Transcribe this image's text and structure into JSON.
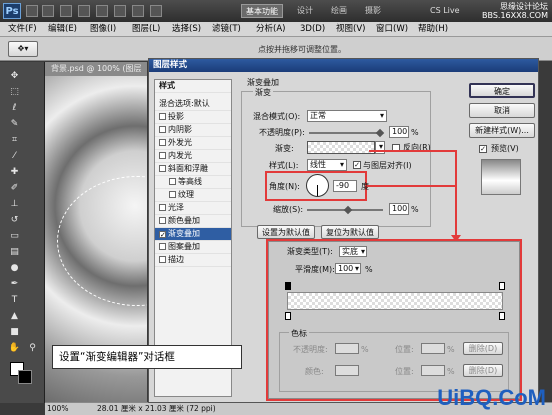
{
  "topbar": {
    "logo": "Ps",
    "workspace": "基本功能",
    "tabs": [
      "设计",
      "绘画",
      "摄影"
    ],
    "cslive": "CS Live",
    "watermark_line1": "思缘设计论坛",
    "watermark_line2": "BBS.16XX8.COM"
  },
  "menu": [
    "文件(F)",
    "编辑(E)",
    "图像(I)",
    "图层(L)",
    "选择(S)",
    "滤镜(T)",
    "分析(A)",
    "3D(D)",
    "视图(V)",
    "窗口(W)",
    "帮助(H)"
  ],
  "optbar": {
    "hint": "点按并拖移可调整位置。"
  },
  "document": {
    "tab": "背景.psd @ 100% (图层"
  },
  "statusbar": {
    "zoom": "100%",
    "info": "28.01 厘米 x 21.03 厘米 (72 ppi)"
  },
  "dialog": {
    "title": "图层样式",
    "styles_header": "样式",
    "blend_options": "混合选项:默认",
    "style_items": [
      "投影",
      "内阴影",
      "外发光",
      "内发光",
      "斜面和浮雕",
      "等高线",
      "纹理",
      "光泽",
      "颜色叠加",
      "渐变叠加",
      "图案叠加",
      "描边"
    ],
    "section_title": "渐变叠加",
    "group_title": "渐变",
    "blend_mode_label": "混合模式(O):",
    "blend_mode_value": "正常",
    "opacity_label": "不透明度(P):",
    "opacity_value": "100",
    "gradient_label": "渐变:",
    "reverse_label": "反向(R)",
    "style_label": "样式(L):",
    "style_value": "线性",
    "align_label": "与图层对齐(I)",
    "angle_label": "角度(N):",
    "angle_value": "-90",
    "angle_unit": "度",
    "scale_label": "缩放(S):",
    "scale_value": "100",
    "percent": "%",
    "set_default": "设置为默认值",
    "reset_default": "复位为默认值",
    "buttons": {
      "ok": "确定",
      "cancel": "取消",
      "new_style": "新建样式(W)...",
      "preview": "预览(V)"
    }
  },
  "editor": {
    "type_label": "渐变类型(T):",
    "type_value": "实底",
    "smooth_label": "平滑度(M):",
    "smooth_value": "100",
    "percent": "%",
    "stops_title": "色标",
    "opacity_label": "不透明度:",
    "location_label": "位置:",
    "delete": "删除(D)",
    "color_label": "颜色:"
  },
  "callout": "设置“渐变编辑器”对话框",
  "watermark": "UiBQ.CoM"
}
